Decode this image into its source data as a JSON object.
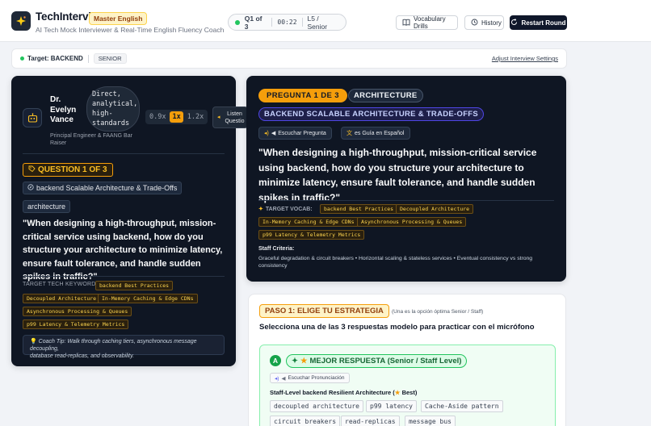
{
  "header": {
    "brand": "TechInterview",
    "badge": "Master English",
    "subtitle": "AI Tech Mock Interviewer & Real-Time English Fluency Coach",
    "status": {
      "question": "Q1 of 3",
      "timer": "00:22",
      "level": "L5 / Senior"
    },
    "buttons": {
      "vocab": "Vocabulary Drills",
      "history": "History",
      "restart": "Restart Round"
    }
  },
  "target_bar": {
    "label": "Target: BACKEND",
    "level": "SENIOR",
    "adjust": "Adjust Interview Settings"
  },
  "interviewer": {
    "name_line1": "Dr.",
    "name_line2": "Evelyn",
    "name_line3": "Vance",
    "style_lines": [
      "Direct,",
      "analytical,",
      "high-",
      "standards"
    ],
    "speeds": [
      "0.9x",
      "1x",
      "1.2x"
    ],
    "listen_label_1": "Listen",
    "listen_label_2": "Questio",
    "role_line1": "Principal Engineer & FAANG Bar",
    "role_line2": "Raiser"
  },
  "left_question": {
    "badge": "QUESTION 1 OF 3",
    "topic": "backend Scalable Architecture & Trade-Offs",
    "category": "architecture",
    "text": "\"When designing a high-throughput, mission-critical service using backend, how do you structure your architecture to minimize latency, ensure fault tolerance, and handle sudden spikes in traffic?\"",
    "keywords_label": "TARGET TECH KEYWORDS:",
    "keywords": [
      "backend Best Practices",
      "Decoupled Architecture",
      "In-Memory Caching & Edge CDNs",
      "Asynchronous Processing & Queues",
      "p99 Latency & Telemetry Metrics"
    ],
    "coach_tip_line1": "Coach Tip: Walk through caching tiers, asynchronous message decoupling,",
    "coach_tip_line2": "database read-replicas, and observability."
  },
  "question_card": {
    "badge": "PREGUNTA 1 DE 3",
    "category": "ARCHITECTURE",
    "topic": "BACKEND SCALABLE ARCHITECTURE & TRADE-OFFS",
    "listen": "Escuchar Pregunta",
    "guide": "es Guía en Español",
    "text": "\"When designing a high-throughput, mission-critical service using backend, how do you structure your architecture to minimize latency, ensure fault tolerance, and handle sudden spikes in traffic?\"",
    "vocab_label": "TARGET VOCAB:",
    "vocab": [
      "backend Best Practices",
      "Decoupled Architecture",
      "In-Memory Caching & Edge CDNs",
      "Asynchronous Processing & Queues",
      "p99 Latency & Telemetry Metrics"
    ],
    "criteria_label": "Staff Criteria:",
    "criteria_line1": "Graceful degradation & circuit breakers • Horizontal scaling & stateless services • Eventual consistency vs strong",
    "criteria_line2": "consistency"
  },
  "strategy": {
    "badge": "PASO 1: ELIGE TU ESTRATEGIA",
    "sub": "(Una es la opción óptima Senior / Staff)",
    "title": "Selecciona una de las 3 respuestas modelo para practicar con el micrófono",
    "answer": {
      "letter": "A",
      "label": "MEJOR RESPUESTA (Senior / Staff Level)",
      "pron": "Escuchar Pronunciación",
      "title_pre": "Staff-Level backend Resilient Architecture (",
      "title_post": " Best)",
      "tags": [
        "decoupled architecture",
        "p99 latency",
        "Cache-Aside pattern",
        "circuit breakers",
        "read-replicas",
        "message bus"
      ]
    }
  },
  "colors": {
    "accent": "#f59e0b",
    "dark_card": "#0f1623",
    "success": "#16a34a"
  }
}
